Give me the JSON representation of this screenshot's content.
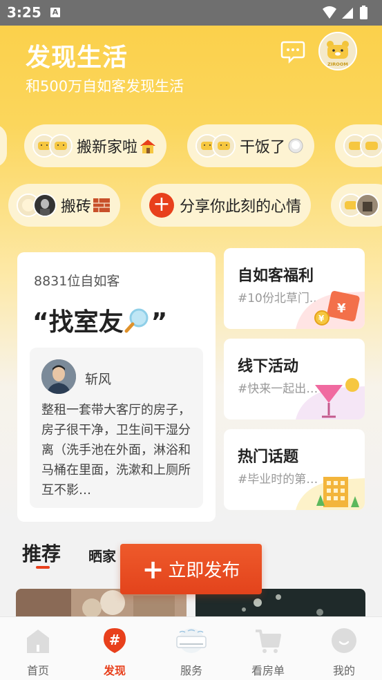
{
  "status_bar": {
    "time": "3:25",
    "notification_badge": "A"
  },
  "header": {
    "title": "发现生活",
    "subtitle": "和500万自如客发现生活",
    "avatar_text": "ZIROOM"
  },
  "chips_row1": [
    {
      "label": "搬新家啦",
      "emoji": "house-emoji"
    },
    {
      "label": "干饭了",
      "emoji": "rice-bowl-emoji"
    }
  ],
  "chips_row2": [
    {
      "label": "搬砖",
      "emoji": "brick-emoji"
    },
    {
      "label": "分享你此刻的心情",
      "emoji": ""
    }
  ],
  "main_card": {
    "count_text": "8831位自如客",
    "title_open": "“找室友",
    "title_close": "”",
    "post": {
      "author": "斩风",
      "text": "整租一套带大客厅的房子，房子很干净，卫生间干湿分离（洗手池在外面，淋浴和马桶在里面，洗漱和上厕所互不影…"
    }
  },
  "side_cards": [
    {
      "title": "自如客福利",
      "subtitle": "#10份北草门..."
    },
    {
      "title": "线下活动",
      "subtitle": "#快来一起出门..."
    },
    {
      "title": "热门话题",
      "subtitle": "#毕业时的第一..."
    }
  ],
  "tabs": {
    "recommend": "推荐",
    "show_home": "晒家"
  },
  "publish": {
    "plus": "+",
    "label": "立即发布"
  },
  "bottom_nav": [
    {
      "label": "首页",
      "icon": "home-icon",
      "active": false
    },
    {
      "label": "发现",
      "icon": "hashtag-icon",
      "active": true
    },
    {
      "label": "服务",
      "icon": "air-conditioner-icon",
      "active": false
    },
    {
      "label": "看房单",
      "icon": "cart-icon",
      "active": false
    },
    {
      "label": "我的",
      "icon": "smile-face-icon",
      "active": false
    }
  ],
  "colors": {
    "accent": "#e8401c",
    "header_yellow": "#fbcf47",
    "chip_bg": "#fdf3d2"
  }
}
